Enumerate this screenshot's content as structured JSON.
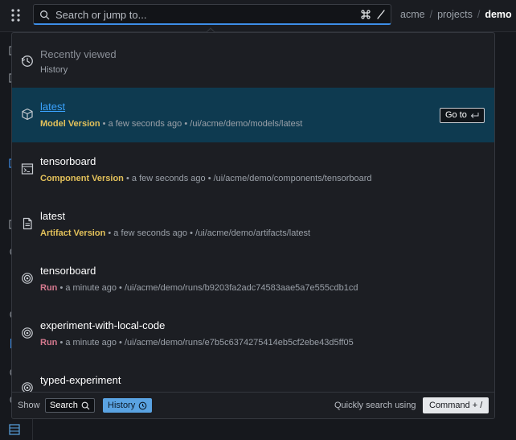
{
  "search": {
    "placeholder": "Search or jump to..."
  },
  "breadcrumb": {
    "org": "acme",
    "section": "projects",
    "current": "demo",
    "separator": "/"
  },
  "recent": {
    "title": "Recently viewed",
    "subtitle": "History"
  },
  "results": [
    {
      "title": "latest",
      "kind": "Model Version",
      "kind_color": "#e3c15a",
      "time": "a few seconds ago",
      "path": "/ui/acme/demo/models/latest",
      "icon": "cube-icon",
      "active": true
    },
    {
      "title": "tensorboard",
      "kind": "Component Version",
      "kind_color": "#e3c15a",
      "time": "a few seconds ago",
      "path": "/ui/acme/demo/components/tensorboard",
      "icon": "terminal-icon",
      "active": false
    },
    {
      "title": "latest",
      "kind": "Artifact Version",
      "kind_color": "#e3c15a",
      "time": "a few seconds ago",
      "path": "/ui/acme/demo/artifacts/latest",
      "icon": "document-icon",
      "active": false
    },
    {
      "title": "tensorboard",
      "kind": "Run",
      "kind_color": "#d4788e",
      "time": "a minute ago",
      "path": "/ui/acme/demo/runs/b9203fa2adc74583aae5a7e555cdb1cd",
      "icon": "run-target-icon",
      "active": false
    },
    {
      "title": "experiment-with-local-code",
      "kind": "Run",
      "kind_color": "#d4788e",
      "time": "a minute ago",
      "path": "/ui/acme/demo/runs/e7b5c6374275414eb5cf2ebe43d5ff05",
      "icon": "run-target-icon",
      "active": false
    },
    {
      "title": "typed-experiment",
      "kind": "",
      "kind_color": "#d4788e",
      "time": "",
      "path": "",
      "icon": "run-target-icon",
      "active": false
    }
  ],
  "meta_separator": "•",
  "goto": {
    "label": "Go to"
  },
  "footer": {
    "show_label": "Show",
    "search_chip": "Search",
    "history_chip": "History",
    "quick_label": "Quickly search using",
    "shortcut": "Command + /"
  },
  "colors": {
    "accent": "#3d8ee8",
    "active_row": "#0e3a50",
    "history_chip": "#5aa3e2"
  }
}
